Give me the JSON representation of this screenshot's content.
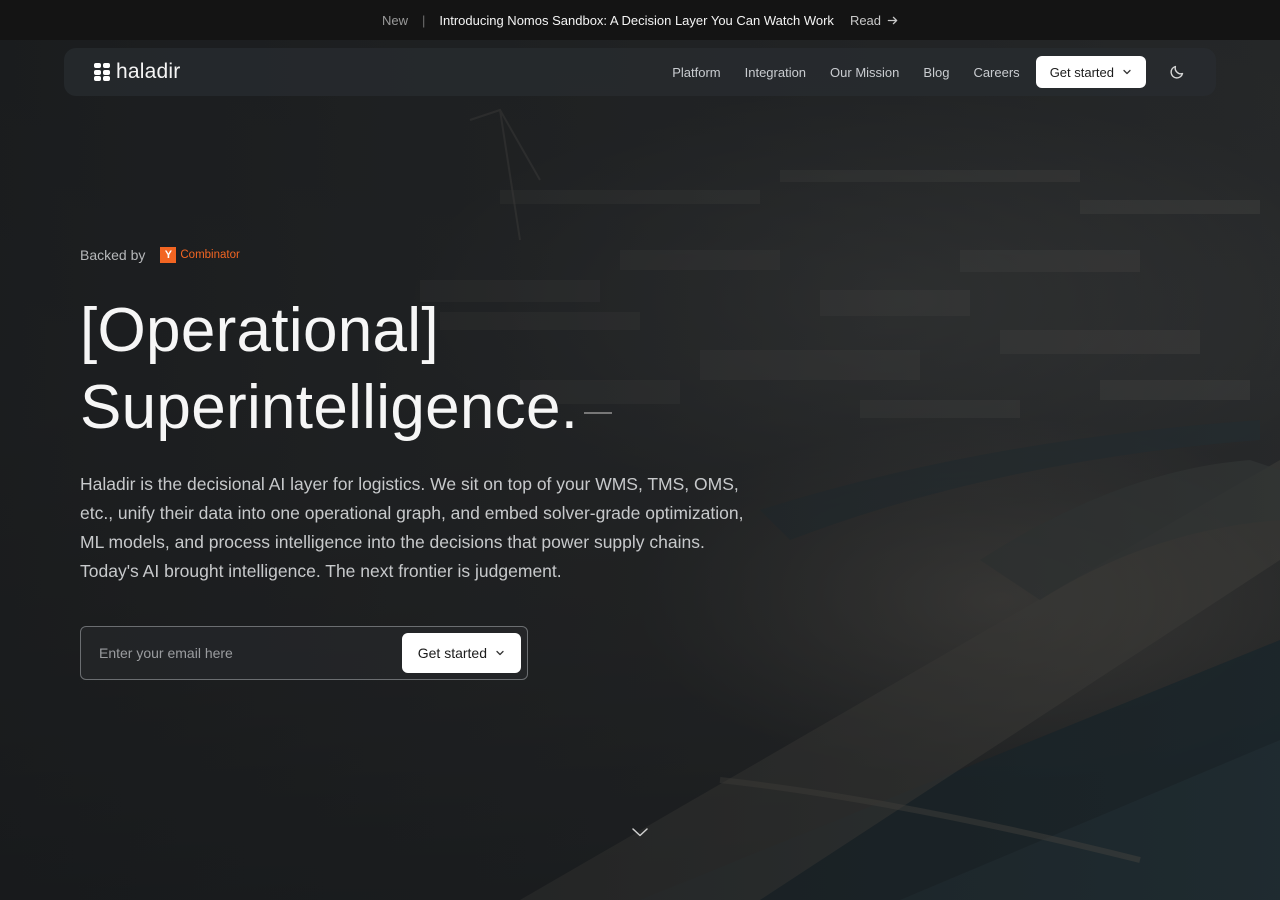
{
  "announcement": {
    "tag": "New",
    "separator": "|",
    "headline": "Introducing Nomos Sandbox: A Decision Layer You Can Watch Work",
    "link_label": "Read"
  },
  "nav": {
    "logo_text": "haladir",
    "links": [
      "Platform",
      "Integration",
      "Our Mission",
      "Blog",
      "Careers"
    ],
    "cta_label": "Get started"
  },
  "hero": {
    "backed_by_label": "Backed by",
    "backer_badge": "Y",
    "backer_name": "Combinator",
    "headline_line1": "[Operational]",
    "headline_line2": "Superintelligence.",
    "description": "Haladir is the decisional AI layer for logistics. We sit on top of your WMS, TMS, OMS, etc., unify their data into one operational graph, and embed solver-grade optimization, ML models, and process intelligence into the decisions that power supply chains. Today's AI brought intelligence. The next frontier is judgement.",
    "email_placeholder": "Enter your email here",
    "cta_label": "Get started"
  },
  "colors": {
    "yc_orange": "#f26522",
    "button_bg": "#ffffff",
    "announcement_bg": "#141414"
  }
}
